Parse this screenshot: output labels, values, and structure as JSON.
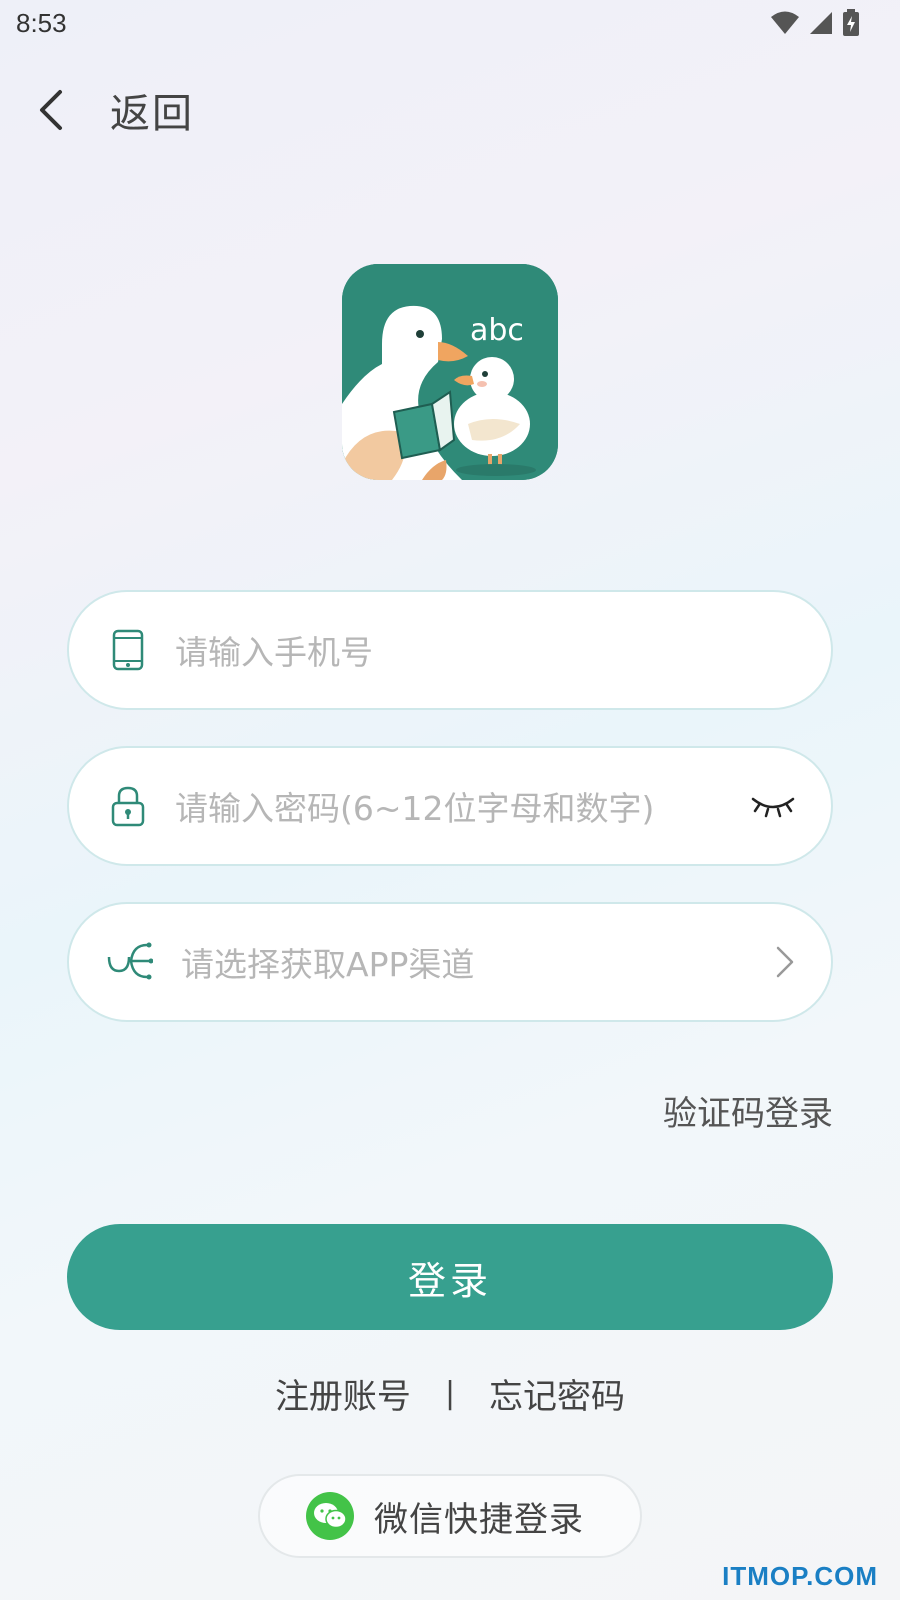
{
  "status_bar": {
    "time": "8:53"
  },
  "nav": {
    "back_label": "返回"
  },
  "form": {
    "phone_placeholder": "请输入手机号",
    "password_placeholder": "请输入密码(6~12位字母和数字)",
    "channel_placeholder": "请选择获取APP渠道",
    "sms_login_label": "验证码登录",
    "login_button_label": "登录"
  },
  "links": {
    "register_label": "注册账号",
    "divider": "|",
    "forgot_label": "忘记密码"
  },
  "wechat": {
    "label": "微信快捷登录"
  },
  "watermark": "ITMOP.COM",
  "colors": {
    "accent": "#37a08f",
    "logo_bg": "#2f8a78",
    "wechat": "#43c348"
  },
  "icons": [
    "signal-icon",
    "wifi-icon",
    "battery-icon",
    "back-chevron-icon",
    "phone-icon",
    "lock-icon",
    "eye-closed-icon",
    "channel-icon",
    "chevron-right-icon",
    "wechat-icon"
  ]
}
